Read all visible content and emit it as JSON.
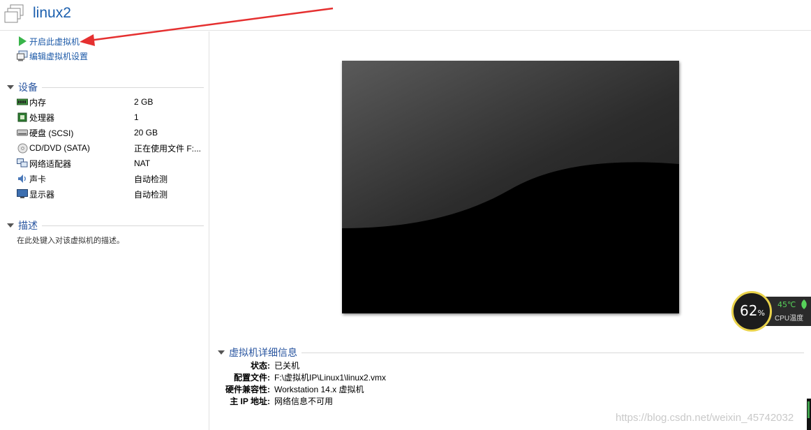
{
  "header": {
    "title": "linux2",
    "vm_icon": "vm-stack-icon"
  },
  "actions": [
    {
      "label": "开启此虚拟机",
      "icon": "play-icon"
    },
    {
      "label": "编辑虚拟机设置",
      "icon": "edit-settings-icon"
    }
  ],
  "devices": {
    "section_label": "设备",
    "items": [
      {
        "name": "内存",
        "value": "2 GB",
        "icon": "memory-icon"
      },
      {
        "name": "处理器",
        "value": "1",
        "icon": "processor-icon"
      },
      {
        "name": "硬盘 (SCSI)",
        "value": "20 GB",
        "icon": "harddisk-icon"
      },
      {
        "name": "CD/DVD (SATA)",
        "value": "正在使用文件 F:...",
        "icon": "cdrom-icon"
      },
      {
        "name": "网络适配器",
        "value": "NAT",
        "icon": "network-adapter-icon"
      },
      {
        "name": "声卡",
        "value": "自动检测",
        "icon": "sound-card-icon"
      },
      {
        "name": "显示器",
        "value": "自动检测",
        "icon": "display-icon"
      }
    ]
  },
  "description": {
    "section_label": "描述",
    "placeholder": "在此处键入对该虚拟机的描述。"
  },
  "details": {
    "section_label": "虚拟机详细信息",
    "rows": [
      {
        "key": "状态:",
        "value": "已关机"
      },
      {
        "key": "配置文件:",
        "value": "F:\\虚拟机IP\\Linux1\\linux2.vmx"
      },
      {
        "key": "硬件兼容性:",
        "value": "Workstation 14.x 虚拟机"
      },
      {
        "key": "主 IP 地址:",
        "value": "网络信息不可用"
      }
    ]
  },
  "cpu_widget": {
    "usage_value": "62",
    "usage_unit": "%",
    "temperature": "45℃",
    "label": "CPU温度",
    "ring_color": "#e9d24a",
    "temp_color": "#57d25a"
  },
  "watermark": "https://blog.csdn.net/weixin_45742032",
  "colors": {
    "link": "#1d5aa8",
    "title": "#1b5fae",
    "section": "#2a56a0",
    "arrow": "#e53030"
  }
}
